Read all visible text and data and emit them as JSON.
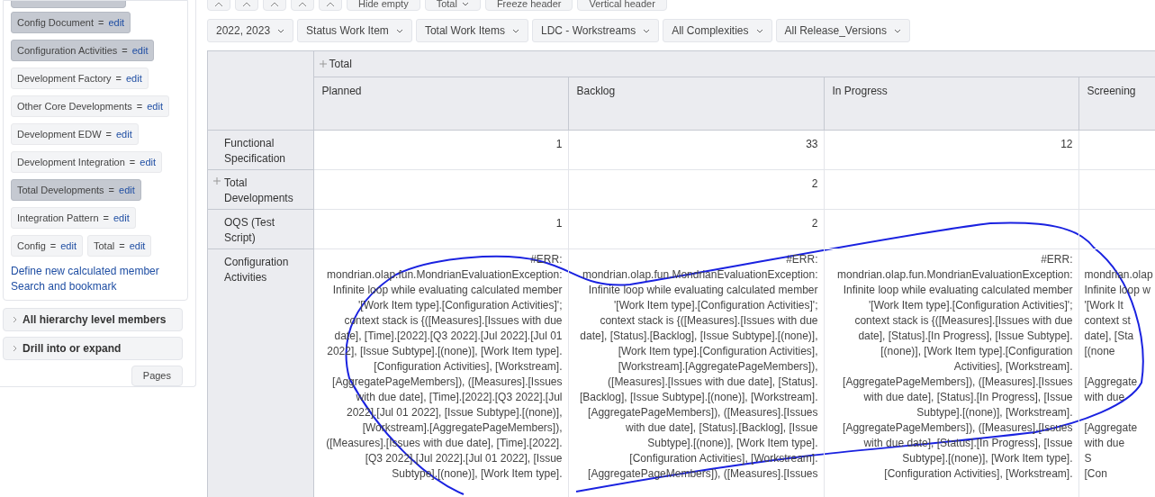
{
  "sidebar": {
    "members": [
      {
        "label": "Config Document",
        "action": "edit",
        "selected": true
      },
      {
        "label": "Configuration Activities",
        "action": "edit",
        "selected": true
      },
      {
        "label": "Development Factory",
        "action": "edit",
        "selected": false
      },
      {
        "label": "Other Core Developments",
        "action": "edit",
        "selected": false
      },
      {
        "label": "Development EDW",
        "action": "edit",
        "selected": false
      },
      {
        "label": "Development Integration",
        "action": "edit",
        "selected": false
      },
      {
        "label": "Total Developments",
        "action": "edit",
        "selected": true
      },
      {
        "label": "Integration Pattern",
        "action": "edit",
        "selected": false
      },
      {
        "label": "Config",
        "action": "edit",
        "selected": false
      },
      {
        "label": "Total",
        "action": "edit",
        "selected": false
      }
    ],
    "separator": "=",
    "links": [
      "Define new calculated member",
      "Search and bookmark"
    ],
    "sections": [
      {
        "label": "All hierarchy level members",
        "expanded": false
      },
      {
        "label": "Drill into or expand",
        "expanded": false
      }
    ],
    "pages_button": "Pages"
  },
  "toolbar": {
    "buttons": [
      {
        "label": "Hide empty",
        "caret": false
      },
      {
        "label": "Total",
        "caret": true
      },
      {
        "label": "Freeze header",
        "caret": false
      },
      {
        "label": "Vertical header",
        "caret": false
      }
    ]
  },
  "filters": [
    "2022, 2023",
    "Status Work Item",
    "Total Work Items",
    "LDC - Workstreams",
    "All Complexities",
    "All Release_Versions"
  ],
  "table": {
    "group_header": "Total",
    "columns": [
      "Planned",
      "Backlog",
      "In Progress",
      "Screening"
    ],
    "rows": [
      {
        "label": "Functional Specification",
        "expandable": false,
        "cells": [
          "1",
          "33",
          "12",
          ""
        ]
      },
      {
        "label": "Total Developments",
        "expandable": true,
        "cells": [
          "",
          "2",
          "",
          ""
        ]
      },
      {
        "label": "OQS (Test Script)",
        "expandable": false,
        "cells": [
          "1",
          "2",
          "",
          ""
        ]
      },
      {
        "label": "Configuration Activities",
        "expandable": false,
        "error_cells": [
          [
            "#ERR:",
            "mondrian.olap.fun.MondrianEvaluationException:",
            "Infinite loop while evaluating calculated member",
            "'[Work Item type].[Configuration Activities]';",
            "context stack is {([Measures].[Issues with due",
            "date], [Time].[2022].[Q3 2022].[Jul 2022].[Jul 01",
            "2022], [Issue Subtype].[(none)], [Work Item type].",
            "[Configuration Activities], [Workstream].",
            "[AggregatePageMembers]), ([Measures].[Issues",
            "with due date], [Time].[2022].[Q3 2022].[Jul",
            "2022].[Jul 01 2022], [Issue Subtype].[(none)],",
            "[Workstream].[AggregatePageMembers]),",
            "([Measures].[Issues with due date], [Time].[2022].",
            "[Q3 2022].[Jul 2022].[Jul 01 2022], [Issue",
            "Subtype].[(none)], [Work Item type]."
          ],
          [
            "#ERR:",
            "mondrian.olap.fun.MondrianEvaluationException:",
            "Infinite loop while evaluating calculated member",
            "'[Work Item type].[Configuration Activities]';",
            "context stack is {([Measures].[Issues with due",
            "date], [Status].[Backlog], [Issue Subtype].[(none)],",
            "[Work Item type].[Configuration Activities],",
            "[Workstream].[AggregatePageMembers]),",
            "([Measures].[Issues with due date], [Status].",
            "[Backlog], [Issue Subtype].[(none)], [Workstream].",
            "[AggregatePageMembers]), ([Measures].[Issues",
            "with due date], [Status].[Backlog], [Issue",
            "Subtype].[(none)], [Work Item type].",
            "[Configuration Activities], [Workstream].",
            "[AggregatePageMembers]), ([Measures].[Issues"
          ],
          [
            "#ERR:",
            "mondrian.olap.fun.MondrianEvaluationException:",
            "Infinite loop while evaluating calculated member",
            "'[Work Item type].[Configuration Activities]';",
            "context stack is {([Measures].[Issues with due",
            "date], [Status].[In Progress], [Issue Subtype].",
            "[(none)], [Work Item type].[Configuration",
            "Activities], [Workstream].",
            "[AggregatePageMembers]), ([Measures].[Issues",
            "with due date], [Status].[In Progress], [Issue",
            "Subtype].[(none)], [Workstream].",
            "[AggregatePageMembers]), ([Measures].[Issues",
            "with due date], [Status].[In Progress], [Issue",
            "Subtype].[(none)], [Work Item type].",
            "[Configuration Activities], [Workstream]."
          ],
          [
            "",
            "mondrian.olap",
            "Infinite loop w",
            "'[Work It",
            "context st",
            "date], [Sta",
            "[(none",
            "",
            "[Aggregate",
            "with due",
            "",
            "[Aggregate",
            "with due",
            "S",
            "[Con"
          ]
        ]
      }
    ]
  }
}
